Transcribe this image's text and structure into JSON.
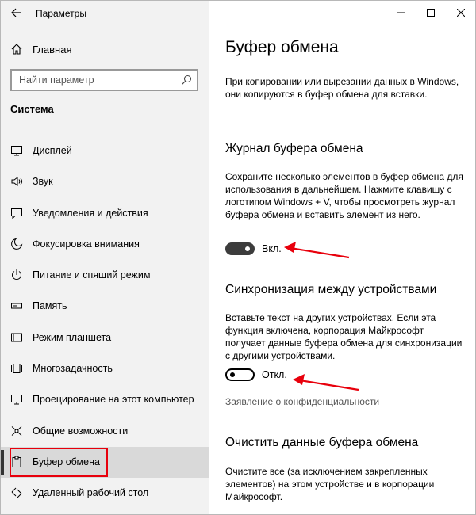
{
  "window": {
    "title": "Параметры",
    "controls": {
      "minimize": "minimize",
      "maximize": "maximize",
      "close": "close"
    }
  },
  "sidebar": {
    "home_label": "Главная",
    "search_placeholder": "Найти параметр",
    "section_title": "Система",
    "items": [
      {
        "label": "Дисплей",
        "icon": "monitor-icon"
      },
      {
        "label": "Звук",
        "icon": "speaker-icon"
      },
      {
        "label": "Уведомления и действия",
        "icon": "notification-icon"
      },
      {
        "label": "Фокусировка внимания",
        "icon": "moon-icon"
      },
      {
        "label": "Питание и спящий режим",
        "icon": "power-icon"
      },
      {
        "label": "Память",
        "icon": "storage-icon"
      },
      {
        "label": "Режим планшета",
        "icon": "tablet-icon"
      },
      {
        "label": "Многозадачность",
        "icon": "multitask-icon"
      },
      {
        "label": "Проецирование на этот компьютер",
        "icon": "project-icon"
      },
      {
        "label": "Общие возможности",
        "icon": "shared-icon"
      },
      {
        "label": "Буфер обмена",
        "icon": "clipboard-icon",
        "selected": true
      },
      {
        "label": "Удаленный рабочий стол",
        "icon": "remote-desktop-icon"
      }
    ]
  },
  "main": {
    "title": "Буфер обмена",
    "intro": "При копировании или вырезании данных в Windows, они копируются в буфер обмена для вставки.",
    "history": {
      "heading": "Журнал буфера обмена",
      "description": "Сохраните несколько элементов в буфер обмена для использования в дальнейшем. Нажмите клавишу с логотипом Windows + V, чтобы просмотреть журнал буфера обмена и вставить элемент из него.",
      "toggle_state": "on",
      "toggle_label": "Вкл."
    },
    "sync": {
      "heading": "Синхронизация между устройствами",
      "description": "Вставьте текст на других устройствах. Если эта функция включена, корпорация Майкрософт получает данные буфера обмена для синхронизации с другими устройствами.",
      "toggle_state": "off",
      "toggle_label": "Откл."
    },
    "privacy_link": "Заявление о конфиденциальности",
    "clear": {
      "heading": "Очистить данные буфера обмена",
      "description": "Очистите все (за исключением закрепленных элементов) на этом устройстве и в корпорации Майкрософт."
    }
  },
  "annotations": {
    "arrow_color": "#e8000c"
  }
}
